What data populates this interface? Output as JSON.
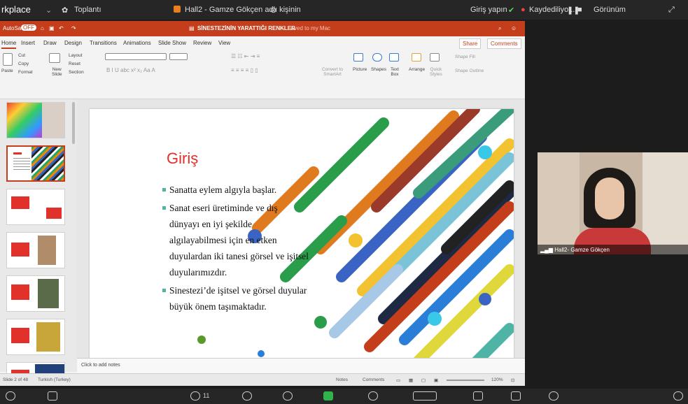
{
  "zoom": {
    "workspace_label": "rkplace",
    "meeting_label": "Toplantı",
    "share_title": "Hall2 - Gamze Gökçen adlı kişinin",
    "right_labels": [
      "Giriş yapın",
      "Kaydediliyor...",
      "Görünüm"
    ],
    "participants_count": "11"
  },
  "ppt": {
    "autosave": "AutoSave",
    "autosave_state": "OFF",
    "doc_title": "SİNESTEZİNİN YARATTIĞI RENKLER",
    "saved": "— Saved to my Mac",
    "tabs": [
      "Home",
      "Insert",
      "Draw",
      "Design",
      "Transitions",
      "Animations",
      "Slide Show",
      "Review",
      "View"
    ],
    "share": "Share",
    "comments": "Comments",
    "ribbon": {
      "paste": "Paste",
      "cut": "Cut",
      "copy": "Copy",
      "format": "Format",
      "new_slide": "New\nSlide",
      "layout": "Layout",
      "reset": "Reset",
      "section": "Section",
      "convert": "Convert to\nSmartArt",
      "picture": "Picture",
      "shapes": "Shapes",
      "textbox": "Text\nBox",
      "arrange": "Arrange",
      "quick_styles": "Quick\nStyles",
      "shape_fill": "Shape Fill",
      "shape_outline": "Shape Outline"
    },
    "slide": {
      "title": "Giriş",
      "bullets": [
        "Sanatta eylem algıyla başlar.",
        "Sanat eseri üretiminde ve dış dünyayı en iyi şekilde algılayabilmesi için en etken duyulardan iki tanesi görsel ve işitsel duyularımızdır.",
        "Sinestezi’de işitsel ve görsel duyular büyük önem taşımaktadır."
      ]
    },
    "notes_placeholder": "Click to add notes",
    "status": {
      "slide_count": "Slide 2 of 48",
      "language": "Turkish (Turkey)",
      "notes": "Notes",
      "comments": "Comments",
      "zoom": "120%"
    }
  },
  "video": {
    "name": "Hall2- Gamze Gökçen"
  }
}
